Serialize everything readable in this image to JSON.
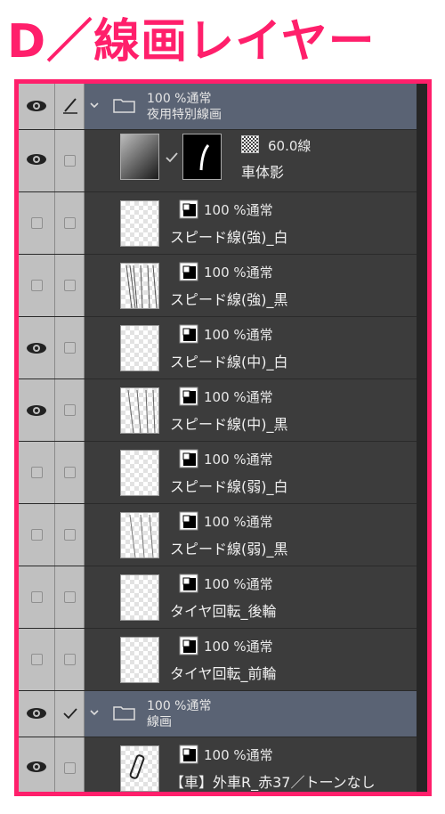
{
  "heading": "D／線画レイヤー",
  "colors": {
    "accent": "#ff1f6b",
    "panel": "#3c3c3c",
    "folder_row": "#5a6374"
  },
  "folder1": {
    "opacity_blend": "100 %通常",
    "name": "夜用特別線画"
  },
  "special": {
    "tone": "60.0線",
    "name": "車体影"
  },
  "layers": [
    {
      "pct": "100 %通常",
      "name": "スピード線(強)_白"
    },
    {
      "pct": "100 %通常",
      "name": "スピード線(強)_黒"
    },
    {
      "pct": "100 %通常",
      "name": "スピード線(中)_白"
    },
    {
      "pct": "100 %通常",
      "name": "スピード線(中)_黒"
    },
    {
      "pct": "100 %通常",
      "name": "スピード線(弱)_白"
    },
    {
      "pct": "100 %通常",
      "name": "スピード線(弱)_黒"
    },
    {
      "pct": "100 %通常",
      "name": "タイヤ回転_後輪"
    },
    {
      "pct": "100 %通常",
      "name": "タイヤ回転_前輪"
    }
  ],
  "folder2": {
    "opacity_blend": "100 %通常",
    "name": "線画"
  },
  "last": {
    "pct": "100 %通常",
    "name": "【車】外車R_赤37／トーンなし"
  },
  "icons": [
    "eye-icon",
    "pen-icon",
    "check-icon",
    "chevron-down-icon",
    "folder-icon",
    "layer-color-icon",
    "tone-icon"
  ]
}
